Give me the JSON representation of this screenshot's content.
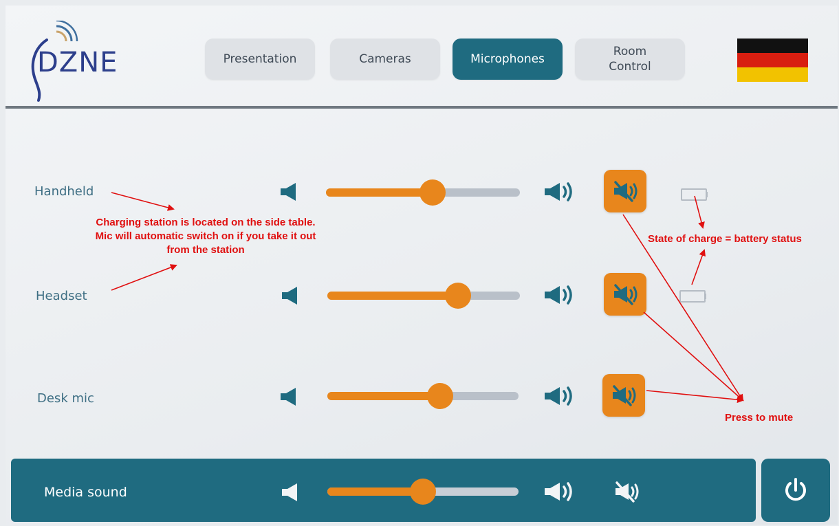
{
  "header": {
    "logo_text": "DZNE",
    "tabs": [
      {
        "label": "Presentation",
        "active": false
      },
      {
        "label": "Cameras",
        "active": false
      },
      {
        "label": "Microphones",
        "active": true
      },
      {
        "label": "Room\nControl",
        "active": false
      }
    ],
    "language_flag": "german-flag-icon"
  },
  "microphones": [
    {
      "label": "Handheld",
      "volume_fraction": 0.55,
      "muted_icon": "speaker-muted-icon",
      "battery": "battery-icon"
    },
    {
      "label": "Headset",
      "volume_fraction": 0.68,
      "muted_icon": "speaker-muted-icon",
      "battery": "battery-icon"
    },
    {
      "label": "Desk mic",
      "volume_fraction": 0.59,
      "muted_icon": "speaker-muted-icon"
    }
  ],
  "media": {
    "label": "Media sound",
    "volume_fraction": 0.5
  },
  "annotations": {
    "charging": "Charging station is located on the side table.\nMic will automatic switch on if you take it out\nfrom the station",
    "battery": "State of charge = battery status",
    "mute": "Press to mute"
  },
  "colors": {
    "accent": "#1f6b80",
    "orange": "#e8861c",
    "annotation": "#e01010"
  }
}
